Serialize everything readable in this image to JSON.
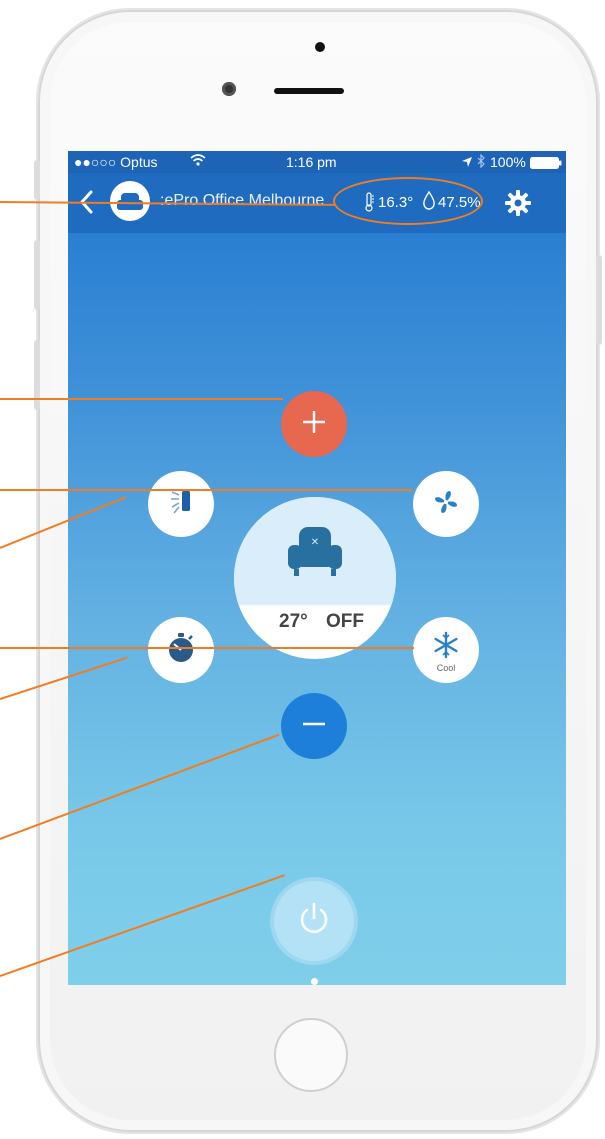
{
  "status_bar": {
    "carrier": "●●○○○ Optus",
    "wifi_icon": "wifi-icon",
    "time": "1:16 pm",
    "location_icon": "location-arrow-icon",
    "bluetooth_icon": "bluetooth-icon",
    "battery": "100%",
    "battery_icon": "battery-icon"
  },
  "header": {
    "back_icon": "chevron-left-icon",
    "device_icon": "armchair-icon",
    "title": ":ePro Office Melbourne",
    "temperature": "16.3°",
    "humidity": "47.5%",
    "thermometer_icon": "thermometer-icon",
    "humidity_icon": "water-drop-icon",
    "settings_icon": "gear-icon"
  },
  "controls": {
    "increase_icon": "plus-icon",
    "swing_icon": "louver-icon",
    "fan_icon": "fan-icon",
    "timer_icon": "stopwatch-icon",
    "mode_icon": "snowflake-icon",
    "mode_label": "Cool",
    "decrease_icon": "minus-icon",
    "power_icon": "power-icon"
  },
  "status_display": {
    "set_temperature": "27°",
    "power_state": "OFF"
  },
  "colors": {
    "accent_orange": "#f07d23",
    "plus_button": "#e8674f",
    "minus_button": "#1d7fd9",
    "header_blue": "#1f6bc0",
    "icon_blue": "#2a7fc9"
  }
}
